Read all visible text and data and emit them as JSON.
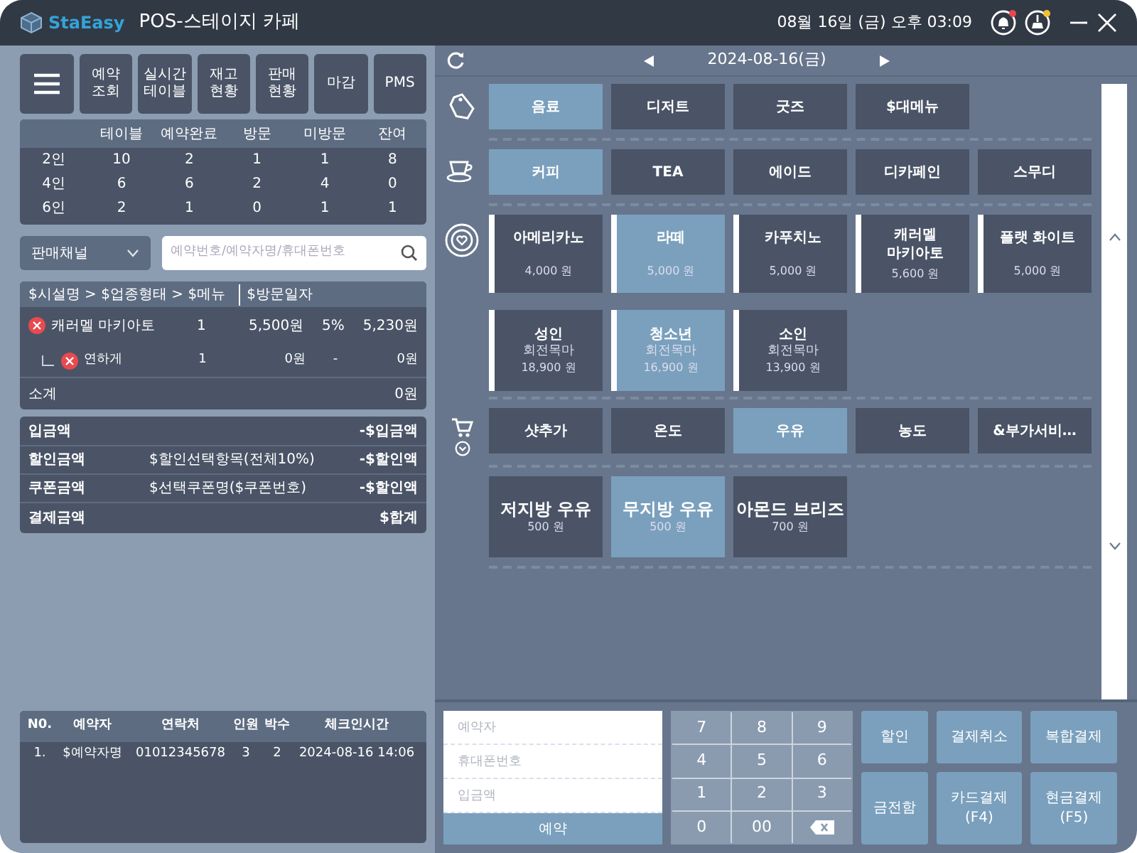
{
  "window": {
    "logo": "StaEasy",
    "title": "POS-스테이지 카페",
    "datetime": "08월 16일 (금) 오후 03:09",
    "indicators": [
      {
        "kind": "bell",
        "color": "#e8484d"
      },
      {
        "kind": "broom",
        "color": "#f2c230"
      }
    ]
  },
  "toolbar": [
    "예약\n조회",
    "실시간\n테이블",
    "재고\n현황",
    "판매\n현황",
    "마감",
    "PMS"
  ],
  "room_stats": {
    "columns": [
      "테이블",
      "예약완료",
      "방문",
      "미방문",
      "잔여"
    ],
    "rows": [
      {
        "label": "2인",
        "values": [
          "10",
          "2",
          "1",
          "1",
          "8"
        ]
      },
      {
        "label": "4인",
        "values": [
          "6",
          "6",
          "2",
          "4",
          "0"
        ]
      },
      {
        "label": "6인",
        "values": [
          "2",
          "1",
          "0",
          "1",
          "1"
        ]
      }
    ]
  },
  "channel_select": {
    "value": "판매채널"
  },
  "search": {
    "placeholder": "예약번호/예약자명/휴대폰번호"
  },
  "order": {
    "path": "$시설명 > $업종형태 > $메뉴",
    "date": "$방문일자",
    "items": [
      {
        "kind": "main",
        "name": "캐러멜 마키아토",
        "qty": "1",
        "price": "5,500원",
        "discount": "5%",
        "total": "5,230원"
      },
      {
        "kind": "option",
        "name": "연하게",
        "qty": "1",
        "price": "0원",
        "discount": "-",
        "total": "0원"
      }
    ],
    "subtotal": {
      "label": "소계",
      "value": "0원"
    }
  },
  "totals": [
    {
      "label": "입금액",
      "value": "-$입금액"
    },
    {
      "label": "할인금액",
      "detail": "$할인선택항목(전체10%)",
      "value": "-$할인액"
    },
    {
      "label": "쿠폰금액",
      "detail": "$선택쿠폰명($쿠폰번호)",
      "value": "-$할인액"
    },
    {
      "label": "결제금액",
      "value": "$합계"
    }
  ],
  "reservations": {
    "columns": [
      "N0.",
      "예약자",
      "연락처",
      "인원",
      "박수",
      "체크인시간"
    ],
    "rows": [
      [
        "1.",
        "$예약자명",
        "01012345678",
        "3",
        "2",
        "2024-08-16 14:06"
      ]
    ]
  },
  "date_nav": {
    "date": "2024-08-16(금)"
  },
  "categories": [
    {
      "label": "음료",
      "selected": true
    },
    {
      "label": "디저트",
      "selected": false
    },
    {
      "label": "굿즈",
      "selected": false
    },
    {
      "label": "$대메뉴",
      "selected": false
    }
  ],
  "subcategories": [
    {
      "label": "커피",
      "selected": true
    },
    {
      "label": "TEA",
      "selected": false
    },
    {
      "label": "에이드",
      "selected": false
    },
    {
      "label": "디카페인",
      "selected": false
    },
    {
      "label": "스무디",
      "selected": false
    }
  ],
  "menu_items": [
    {
      "name": "아메리카노",
      "price": "4,000 원",
      "selected": false
    },
    {
      "name": "라떼",
      "price": "5,000 원",
      "selected": true
    },
    {
      "name": "카푸치노",
      "price": "5,000 원",
      "selected": false
    },
    {
      "name": "캐러멜\n마키아토",
      "price": "5,600 원",
      "selected": false
    },
    {
      "name": "플랫 화이트",
      "price": "5,000 원",
      "selected": false
    },
    {
      "name": "성인",
      "note": "회전목마",
      "price": "18,900 원",
      "selected": false
    },
    {
      "name": "청소년",
      "note": "회전목마",
      "price": "16,900 원",
      "selected": true
    },
    {
      "name": "소인",
      "note": "회전목마",
      "price": "13,900 원",
      "selected": false
    }
  ],
  "options": [
    {
      "label": "샷추가",
      "selected": false
    },
    {
      "label": "온도",
      "selected": false
    },
    {
      "label": "우유",
      "selected": true
    },
    {
      "label": "농도",
      "selected": false
    },
    {
      "label": "&부가서비…",
      "selected": false
    }
  ],
  "option_items": [
    {
      "name": "저지방 우유",
      "price": "500 원",
      "selected": false
    },
    {
      "name": "무지방 우유",
      "price": "500 원",
      "selected": true
    },
    {
      "name": "아몬드 브리즈",
      "price": "700 원",
      "selected": false
    }
  ],
  "reservation_form": {
    "fields": [
      {
        "placeholder": "예약자"
      },
      {
        "placeholder": "휴대폰번호"
      },
      {
        "placeholder": "입금액"
      }
    ],
    "submit": "예약"
  },
  "keypad": [
    {
      "kind": "digit",
      "label": "7"
    },
    {
      "kind": "digit",
      "label": "8"
    },
    {
      "kind": "digit",
      "label": "9"
    },
    {
      "kind": "digit",
      "label": "4"
    },
    {
      "kind": "digit",
      "label": "5"
    },
    {
      "kind": "digit",
      "label": "6"
    },
    {
      "kind": "digit",
      "label": "1"
    },
    {
      "kind": "digit",
      "label": "2"
    },
    {
      "kind": "digit",
      "label": "3"
    },
    {
      "kind": "digit",
      "label": "0"
    },
    {
      "kind": "digit",
      "label": "00"
    },
    {
      "kind": "backspace"
    }
  ],
  "actions": [
    "할인",
    "결제취소",
    "복합결제",
    "금전함",
    "카드결제\n(F4)",
    "현금결제\n(F5)"
  ]
}
